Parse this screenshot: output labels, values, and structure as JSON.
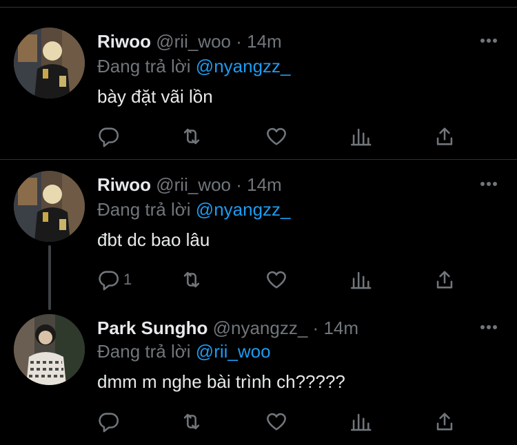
{
  "tweets": [
    {
      "name": "Riwoo",
      "handle": "@rii_woo",
      "time": "14m",
      "replying_prefix": "Đang trả lời",
      "replying_to": "@nyangzz_",
      "text": "bày đặt vãi lồn",
      "reply_count": "",
      "avatar_icon": "user-avatar-riwoo"
    },
    {
      "name": "Riwoo",
      "handle": "@rii_woo",
      "time": "14m",
      "replying_prefix": "Đang trả lời",
      "replying_to": "@nyangzz_",
      "text": "đbt dc bao lâu",
      "reply_count": "1",
      "avatar_icon": "user-avatar-riwoo"
    },
    {
      "name": "Park Sungho",
      "handle": "@nyangzz_",
      "time": "14m",
      "replying_prefix": "Đang trả lời",
      "replying_to": "@rii_woo",
      "text": "dmm m nghe bài trình ch?????",
      "reply_count": "",
      "avatar_icon": "user-avatar-park-sungho"
    }
  ],
  "separator": "·",
  "colors": {
    "background": "#000000",
    "text": "#e7e9ea",
    "muted": "#71767b",
    "link": "#1d9bf0",
    "border": "#2f3336"
  },
  "icons": [
    "more-icon",
    "reply-icon",
    "retweet-icon",
    "like-icon",
    "analytics-icon",
    "share-icon"
  ]
}
